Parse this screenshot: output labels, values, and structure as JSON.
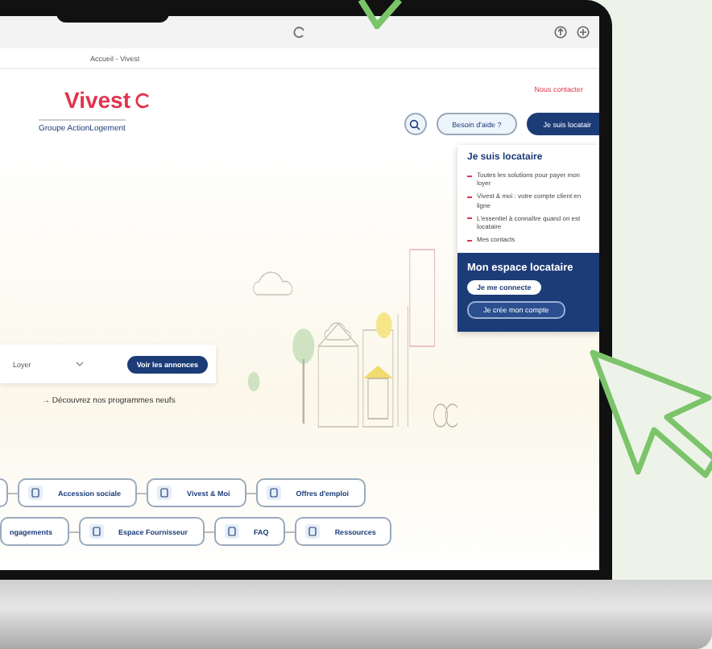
{
  "browser": {
    "breadcrumb": "Accueil - Vivest"
  },
  "header": {
    "contact_link": "Nous contacter",
    "logo": "Vivest",
    "logo_subtitle": "Groupe ActionLogement",
    "buttons": [
      {
        "label": "Besoin d'aide ?",
        "selected": false
      },
      {
        "label": "Je suis locatair",
        "selected": true
      }
    ]
  },
  "menu": {
    "title": "Je suis locataire",
    "items": [
      "Toutes les solutions pour payer mon loyer",
      "Vivest & moi : votre compte client en ligne",
      "L'essentiel à connaître quand on est locataire",
      "Mes contacts"
    ],
    "account_title": "Mon espace locataire",
    "login_button": "Je me connecte",
    "signup_button": "Je crée mon compte"
  },
  "search": {
    "value": "Loyer",
    "button": "Voir les annonces"
  },
  "programs_link": "→ Découvrez nos programmes neufs",
  "shortcuts": [
    [
      "Accession sociale",
      "Vivest & Moi",
      "Offres d'emploi"
    ],
    [
      "ngagements",
      "Espace Fournisseur",
      "FAQ",
      "Ressources"
    ]
  ]
}
